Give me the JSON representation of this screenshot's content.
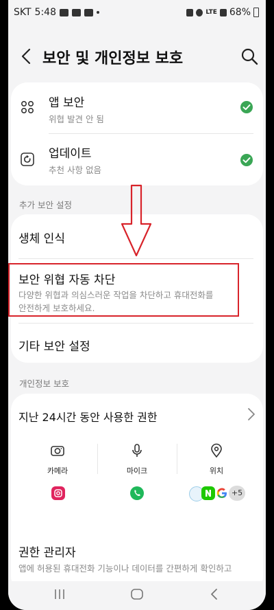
{
  "status_bar": {
    "carrier": "SKT",
    "time": "5:48",
    "network": "LTE",
    "battery": "68%"
  },
  "header": {
    "title": "보안 및 개인정보 보호",
    "back_icon": "chevron-left-icon",
    "search_icon": "search-icon"
  },
  "security_items": [
    {
      "title": "앱 보안",
      "subtitle": "위협 발견 안 됨",
      "icon": "apps-grid-icon",
      "status_color": "#3aa655"
    },
    {
      "title": "업데이트",
      "subtitle": "추천 사항 없음",
      "icon": "update-icon",
      "status_color": "#3aa655"
    }
  ],
  "additional_settings": {
    "label": "추가 보안 설정",
    "items": [
      {
        "title": "생체 인식"
      },
      {
        "title": "보안 위협 자동 차단",
        "subtitle_line1": "다양한 위협과 의심스러운 작업을 차단하고 휴대전화를",
        "subtitle_line2": "안전하게 보호하세요."
      },
      {
        "title": "기타 보안 설정"
      }
    ]
  },
  "privacy": {
    "label": "개인정보 보호",
    "recent_permissions_title": "지난 24시간 동안 사용한 권한",
    "permissions": [
      {
        "label": "카메라",
        "icon": "camera-icon"
      },
      {
        "label": "마이크",
        "icon": "microphone-icon"
      },
      {
        "label": "위치",
        "icon": "location-pin-icon"
      }
    ],
    "more_apps_count": "+5",
    "permission_manager": {
      "title": "권한 관리자",
      "subtitle": "앱에 허용된 휴대전화 기능이나 데이터를 간편하게 확인하고"
    }
  },
  "colors": {
    "highlight_box": "#d8232a",
    "check_green": "#3aa655",
    "background": "#f4f4f5"
  }
}
